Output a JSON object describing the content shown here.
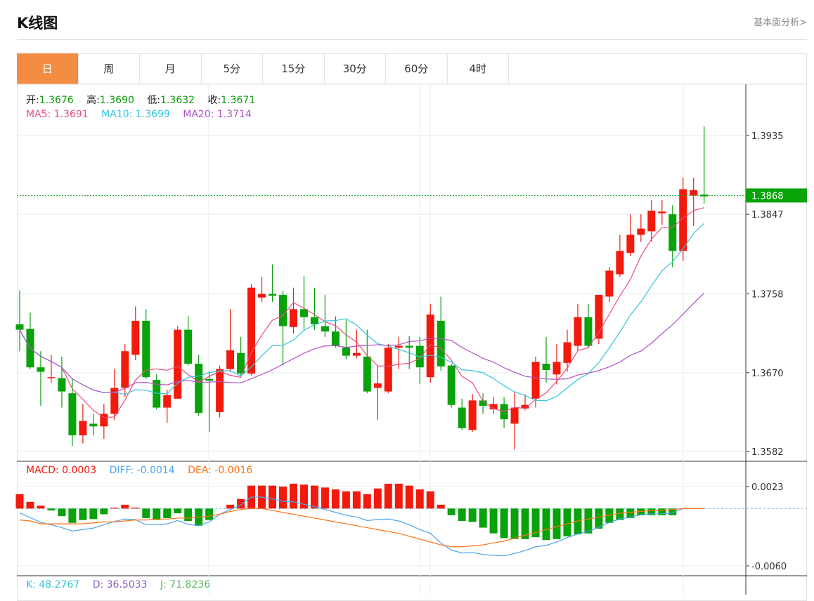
{
  "header": {
    "title": "K线图",
    "link": "基本面分析>"
  },
  "tabs": [
    "日",
    "周",
    "月",
    "5分",
    "15分",
    "30分",
    "60分",
    "4时"
  ],
  "active_tab": 0,
  "ohlc_legend": {
    "open_label": "开:",
    "open": "1.3676",
    "high_label": "高:",
    "high": "1.3690",
    "low_label": "低:",
    "low": "1.3632",
    "close_label": "收:",
    "close": "1.3671"
  },
  "ma_legend": {
    "ma5": "MA5: 1.3691",
    "ma10": "MA10: 1.3699",
    "ma20": "MA20: 1.3714"
  },
  "macd_legend": {
    "macd": "MACD: 0.0003",
    "diff": "DIFF: -0.0014",
    "dea": "DEA: -0.0016"
  },
  "kdj_legend": {
    "k": "K: 48.2767",
    "d": "D: 36.5033",
    "j": "J: 71.8236"
  },
  "colors": {
    "up": "#f21a0c",
    "down": "#08a20a",
    "ma5": "#ec4c84",
    "ma10": "#33c4dc",
    "ma20": "#b052c6",
    "diff": "#4aa3f0",
    "dea": "#ff7212",
    "accent": "#f48c42"
  },
  "chart_data": {
    "type": "candlestick",
    "price_axis_ticks": [
      "1.3935",
      "1.3847",
      "1.3758",
      "1.3670",
      "1.3582"
    ],
    "price_range": [
      1.3582,
      1.3935
    ],
    "current_price": "1.3868",
    "macd_axis_ticks": [
      "0.0023",
      "-0.0060"
    ],
    "macd_range": [
      -0.006,
      0.0023
    ],
    "candles": [
      [
        1.3724,
        1.3762,
        1.3694,
        1.3718
      ],
      [
        1.3719,
        1.3737,
        1.3674,
        1.3676
      ],
      [
        1.3676,
        1.3694,
        1.3633,
        1.3671
      ],
      [
        1.3664,
        1.369,
        1.3659,
        1.3665
      ],
      [
        1.3664,
        1.3688,
        1.3631,
        1.3649
      ],
      [
        1.3647,
        1.3663,
        1.3588,
        1.36
      ],
      [
        1.36,
        1.3635,
        1.3591,
        1.3616
      ],
      [
        1.3613,
        1.3624,
        1.36,
        1.361
      ],
      [
        1.361,
        1.3635,
        1.3596,
        1.3624
      ],
      [
        1.3624,
        1.3674,
        1.3617,
        1.3653
      ],
      [
        1.3653,
        1.3702,
        1.3643,
        1.3694
      ],
      [
        1.369,
        1.3744,
        1.3684,
        1.3728
      ],
      [
        1.3728,
        1.3741,
        1.3663,
        1.3665
      ],
      [
        1.3662,
        1.3668,
        1.3629,
        1.3631
      ],
      [
        1.3631,
        1.3651,
        1.3614,
        1.3645
      ],
      [
        1.3641,
        1.3722,
        1.3641,
        1.3718
      ],
      [
        1.3718,
        1.3733,
        1.3678,
        1.368
      ],
      [
        1.368,
        1.369,
        1.3622,
        1.3625
      ],
      [
        1.3663,
        1.3672,
        1.3604,
        1.3661
      ],
      [
        1.3626,
        1.3678,
        1.362,
        1.3674
      ],
      [
        1.3674,
        1.3741,
        1.3671,
        1.3695
      ],
      [
        1.3692,
        1.371,
        1.3667,
        1.3669
      ],
      [
        1.3669,
        1.3769,
        1.3667,
        1.3765
      ],
      [
        1.3754,
        1.3777,
        1.3749,
        1.3758
      ],
      [
        1.3758,
        1.3791,
        1.3749,
        1.3756
      ],
      [
        1.3757,
        1.3761,
        1.3678,
        1.3722
      ],
      [
        1.3721,
        1.3765,
        1.3714,
        1.3741
      ],
      [
        1.3741,
        1.3778,
        1.3718,
        1.3732
      ],
      [
        1.3732,
        1.3765,
        1.3718,
        1.3724
      ],
      [
        1.3722,
        1.3757,
        1.371,
        1.3716
      ],
      [
        1.3716,
        1.3733,
        1.3698,
        1.37
      ],
      [
        1.3698,
        1.3729,
        1.3685,
        1.3689
      ],
      [
        1.3689,
        1.3718,
        1.3686,
        1.3692
      ],
      [
        1.3688,
        1.3718,
        1.3647,
        1.3649
      ],
      [
        1.3653,
        1.3678,
        1.3617,
        1.3658
      ],
      [
        1.3649,
        1.3702,
        1.3647,
        1.3698
      ],
      [
        1.3698,
        1.371,
        1.3674,
        1.37
      ],
      [
        1.37,
        1.3711,
        1.3674,
        1.3698
      ],
      [
        1.37,
        1.371,
        1.3657,
        1.3676
      ],
      [
        1.3665,
        1.3747,
        1.3659,
        1.3735
      ],
      [
        1.3728,
        1.3755,
        1.3672,
        1.3677
      ],
      [
        1.3678,
        1.368,
        1.3631,
        1.3634
      ],
      [
        1.3631,
        1.3641,
        1.3606,
        1.3608
      ],
      [
        1.3606,
        1.3646,
        1.3604,
        1.3639
      ],
      [
        1.3639,
        1.3647,
        1.3624,
        1.3633
      ],
      [
        1.3629,
        1.3643,
        1.3624,
        1.3635
      ],
      [
        1.3635,
        1.3643,
        1.3608,
        1.3618
      ],
      [
        1.3613,
        1.3649,
        1.3584,
        1.3631
      ],
      [
        1.363,
        1.3646,
        1.3628,
        1.3634
      ],
      [
        1.3641,
        1.3688,
        1.3631,
        1.3682
      ],
      [
        1.368,
        1.371,
        1.3659,
        1.3673
      ],
      [
        1.3668,
        1.3702,
        1.3657,
        1.3682
      ],
      [
        1.3681,
        1.3718,
        1.3671,
        1.3704
      ],
      [
        1.37,
        1.3747,
        1.3694,
        1.3732
      ],
      [
        1.3732,
        1.3747,
        1.3697,
        1.37
      ],
      [
        1.3708,
        1.3757,
        1.3702,
        1.3757
      ],
      [
        1.3755,
        1.3788,
        1.3749,
        1.3784
      ],
      [
        1.378,
        1.3824,
        1.3777,
        1.3806
      ],
      [
        1.3804,
        1.3847,
        1.38,
        1.3824
      ],
      [
        1.3824,
        1.3847,
        1.3816,
        1.3831
      ],
      [
        1.3828,
        1.3863,
        1.3816,
        1.3851
      ],
      [
        1.3848,
        1.3863,
        1.3835,
        1.385
      ],
      [
        1.3847,
        1.3857,
        1.3788,
        1.3806
      ],
      [
        1.3806,
        1.3888,
        1.3795,
        1.3875
      ],
      [
        1.3868,
        1.3888,
        1.3834,
        1.3874
      ],
      [
        1.3869,
        1.3945,
        1.3859,
        1.3867
      ]
    ],
    "macd_hist": [
      0.0015,
      0.0007,
      0.0003,
      -0.0002,
      -0.0008,
      -0.0015,
      -0.0012,
      -0.0011,
      -0.0006,
      0.0001,
      0.0004,
      0.0001,
      -0.001,
      -0.0012,
      -0.001,
      -0.0005,
      -0.0013,
      -0.0018,
      -0.0012,
      0.0,
      0.0004,
      0.001,
      0.0024,
      0.0024,
      0.0024,
      0.0023,
      0.0026,
      0.0025,
      0.0024,
      0.0022,
      0.002,
      0.0018,
      0.0018,
      0.0015,
      0.0021,
      0.0026,
      0.0026,
      0.0024,
      0.002,
      0.0018,
      0.0004,
      -0.0007,
      -0.0013,
      -0.0014,
      -0.002,
      -0.0026,
      -0.0031,
      -0.0032,
      -0.0032,
      -0.003,
      -0.0033,
      -0.0032,
      -0.0029,
      -0.0027,
      -0.0026,
      -0.0021,
      -0.0015,
      -0.0012,
      -0.001,
      -0.0007,
      -0.0007,
      -0.0007,
      -0.0007,
      0.0,
      0.0,
      0.0
    ],
    "dea": [
      -0.0012,
      -0.0013,
      -0.0016,
      -0.0016,
      -0.0016,
      -0.0016,
      -0.0016,
      -0.0015,
      -0.0014,
      -0.0014,
      -0.0013,
      -0.0012,
      -0.0012,
      -0.0011,
      -0.0011,
      -0.001,
      -0.001,
      -0.0009,
      -0.0008,
      -0.0006,
      -0.0003,
      -0.0001,
      0.0,
      0.0,
      -0.0002,
      -0.0004,
      -0.0006,
      -0.0008,
      -0.001,
      -0.0012,
      -0.0014,
      -0.0016,
      -0.0018,
      -0.002,
      -0.0022,
      -0.0024,
      -0.0026,
      -0.0029,
      -0.0032,
      -0.0035,
      -0.0038,
      -0.004,
      -0.004,
      -0.0039,
      -0.0038,
      -0.0036,
      -0.0034,
      -0.0031,
      -0.0028,
      -0.0025,
      -0.0022,
      -0.0019,
      -0.0016,
      -0.0013,
      -0.0011,
      -0.0009,
      -0.0007,
      -0.0005,
      -0.0004,
      -0.0003,
      -0.0002,
      -0.0002,
      -0.0001,
      0.0,
      0.0,
      0.0
    ]
  }
}
